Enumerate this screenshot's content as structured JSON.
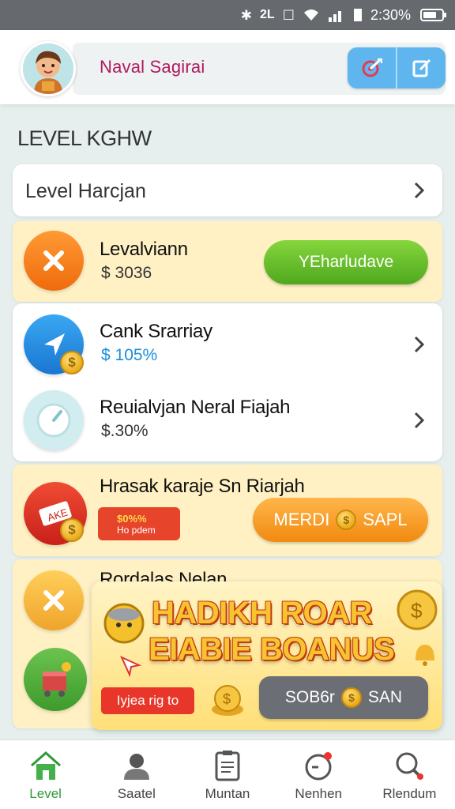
{
  "status_bar": {
    "time": "2:30%",
    "signal_text": "2̶L"
  },
  "header": {
    "user_name": "Naval Sagirai",
    "buttons": [
      {
        "icon": "target-icon"
      },
      {
        "icon": "edit-icon"
      }
    ]
  },
  "section_title": "LEVEL KGHW",
  "level_header": {
    "label": "Level Harcjan"
  },
  "rows": [
    {
      "title": "Levalviann",
      "sub": "$ 3036",
      "button": "YEharludave"
    },
    {
      "title": "Cank Srarriay",
      "sub": "$ 105%"
    },
    {
      "title": "Reuialvjan Neral Fiajah",
      "sub": "$.30%"
    },
    {
      "title": "Hrasak karaje Sn Riarjah",
      "tag_big": "$0%%",
      "tag_small": "Ho pdem",
      "button": "MERDI",
      "button_tail": "SAPL"
    },
    {
      "title": "Rordalas Nelan"
    }
  ],
  "promo": {
    "line1": "HADIKH ROAR",
    "line2": "EIABIE BOANUS",
    "tag": "Iyjea rig to",
    "button": "SOB6r",
    "button_tail": "SAN"
  },
  "nav": [
    {
      "label": "Level",
      "icon": "home-icon",
      "active": true
    },
    {
      "label": "Saatel",
      "icon": "person-icon"
    },
    {
      "label": "Muntan",
      "icon": "clipboard-icon"
    },
    {
      "label": "Nenhen",
      "icon": "timer-icon"
    },
    {
      "label": "Rlendum",
      "icon": "search-icon"
    }
  ],
  "colors": {
    "accent_green": "#4fa81c",
    "accent_orange": "#f18a10",
    "card_yellow": "#fff1c4",
    "name_magenta": "#b0195f",
    "header_button_blue": "#5fb6ee"
  }
}
